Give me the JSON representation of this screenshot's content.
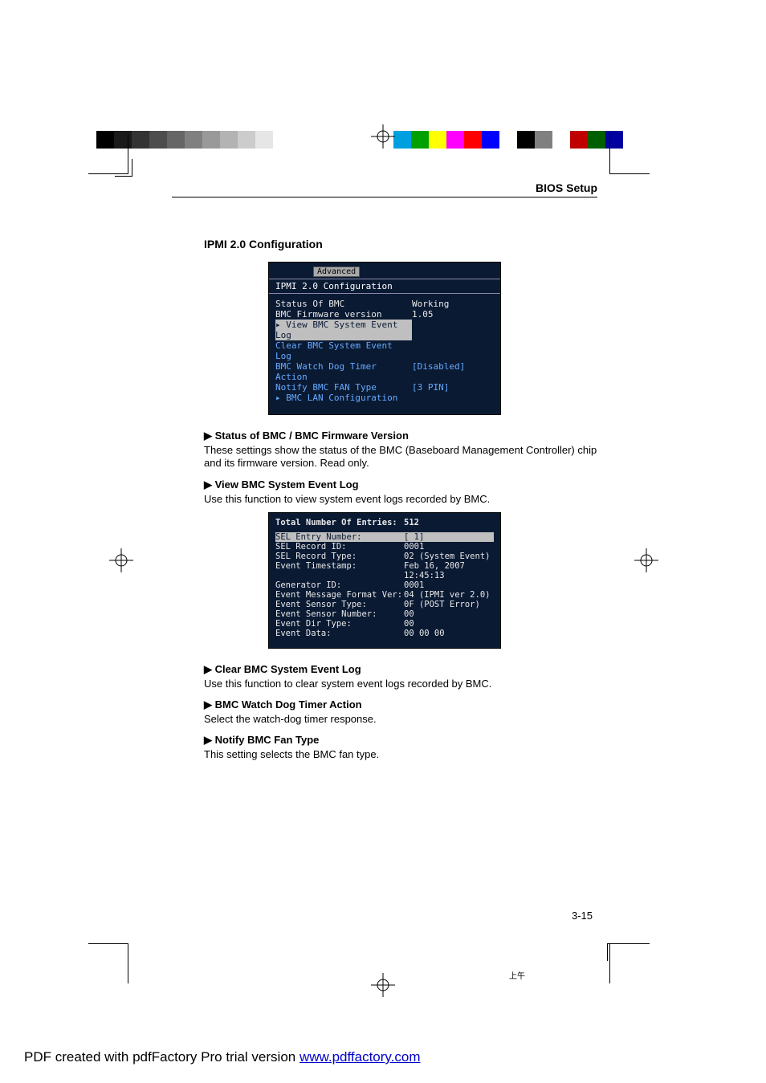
{
  "header": {
    "title": "BIOS Setup"
  },
  "section": {
    "heading": "IPMI 2.0 Configuration"
  },
  "bullets": {
    "b1": {
      "label": "Status of BMC",
      "label2": "/ BMC Firmware Version",
      "text": "These settings show the status of the BMC (Baseboard Management Controller) chip and its firmware version. Read only."
    },
    "b2": {
      "label": "View BMC System Event Log",
      "text": "Use this function to view system event logs recorded by BMC."
    },
    "b3": {
      "label": "Clear BMC System Event Log",
      "text": "Use this function to clear system event logs recorded by BMC."
    },
    "b4": {
      "label": "BMC Watch Dog Timer Action",
      "text": "Select the watch-dog timer response."
    },
    "b5": {
      "label": "Notify BMC Fan Type",
      "text": "This setting selects the BMC fan type."
    }
  },
  "pagenum": "3-15",
  "bios1": {
    "tab": "Advanced",
    "title": "IPMI 2.0 Configuration",
    "rows": [
      {
        "l": "Status Of BMC",
        "r": "Working",
        "cls": ""
      },
      {
        "l": "BMC Firmware version",
        "r": "1.05",
        "cls": ""
      },
      {
        "l": "▸ View BMC System Event Log",
        "r": "",
        "cls": "hi"
      },
      {
        "l": "Clear BMC System Event Log",
        "r": "",
        "cls": "blue"
      },
      {
        "l": "BMC Watch Dog Timer Action",
        "r": "[Disabled]",
        "cls": "blue"
      },
      {
        "l": "Notify BMC FAN Type",
        "r": "[3 PIN]",
        "cls": "blue"
      },
      {
        "l": "▸ BMC LAN Configuration",
        "r": "",
        "cls": "blue"
      }
    ]
  },
  "bios2": {
    "hdr_l": "Total Number Of Entries:",
    "hdr_r": "512",
    "rows": [
      {
        "l": "SEL Entry Number:",
        "r": "[  1]",
        "cls": "hi"
      },
      {
        "l": "SEL Record ID:",
        "r": "0001",
        "cls": ""
      },
      {
        "l": "SEL Record Type:",
        "r": "02 (System Event)",
        "cls": ""
      },
      {
        "l": "Event Timestamp:",
        "r": "Feb 16, 2007 12:45:13",
        "cls": ""
      },
      {
        "l": "Generator ID:",
        "r": "0001",
        "cls": ""
      },
      {
        "l": "Event Message Format Ver:",
        "r": "04 (IPMI ver 2.0)",
        "cls": ""
      },
      {
        "l": "Event Sensor Type:",
        "r": "0F (POST Error)",
        "cls": ""
      },
      {
        "l": "Event Sensor Number:",
        "r": "00",
        "cls": ""
      },
      {
        "l": "Event Dir Type:",
        "r": "00",
        "cls": ""
      },
      {
        "l": "Event Data:",
        "r": "00 00 00",
        "cls": ""
      }
    ]
  },
  "footer": {
    "prefix": "PDF created with pdfFactory Pro trial version ",
    "link": "www.pdffactory.com"
  },
  "timestamp": "上午",
  "swatches_left": [
    "#000000",
    "#1a1a1a",
    "#333333",
    "#4d4d4d",
    "#666666",
    "#808080",
    "#999999",
    "#b3b3b3",
    "#cccccc",
    "#e6e6e6",
    "#ffffff"
  ],
  "swatches_right": [
    "#00a0e0",
    "#00a000",
    "#ffff00",
    "#ff00ff",
    "#ff0000",
    "#0000ff",
    "#ffffff",
    "#000000",
    "#808080",
    "#ffffff",
    "#c00000",
    "#006000",
    "#0000a0"
  ]
}
